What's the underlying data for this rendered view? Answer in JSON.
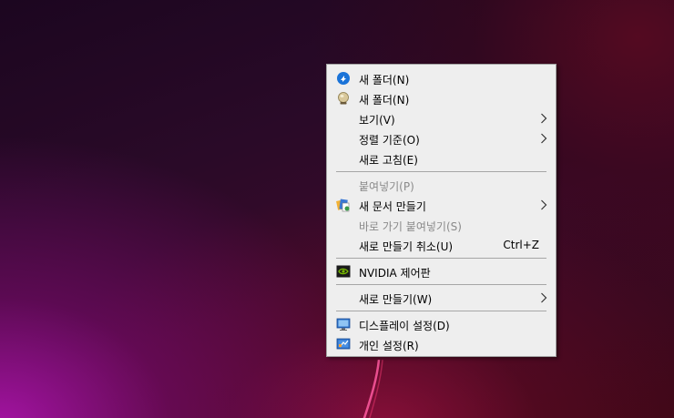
{
  "context_menu": {
    "items": [
      {
        "label": "새 폴더(N)",
        "icon": "blue-circle-arrow-icon"
      },
      {
        "label": "새 폴더(N)",
        "icon": "globe-bulb-icon"
      },
      {
        "label": "보기(V)"
      },
      {
        "label": "정렬 기준(O)"
      },
      {
        "label": "새로 고침(E)"
      },
      {
        "label": "붙여넣기(P)",
        "disabled": true
      },
      {
        "label": "새 문서 만들기",
        "icon": "documents-icon"
      },
      {
        "label": "바로 가기 붙여넣기(S)",
        "disabled": true
      },
      {
        "label": "새로 만들기 취소(U)",
        "shortcut": "Ctrl+Z"
      },
      {
        "label": "NVIDIA 제어판",
        "icon": "nvidia-icon"
      },
      {
        "label": "새로 만들기(W)"
      },
      {
        "label": "디스플레이 설정(D)",
        "icon": "monitor-icon"
      },
      {
        "label": "개인 설정(R)",
        "icon": "personalize-icon"
      }
    ]
  },
  "colors": {
    "menu_background": "#eeeeee",
    "menu_border": "#a0a0a0",
    "separator": "#a6a6a6",
    "disabled_text": "#8a8a8a",
    "nvidia_green": "#76b900"
  }
}
